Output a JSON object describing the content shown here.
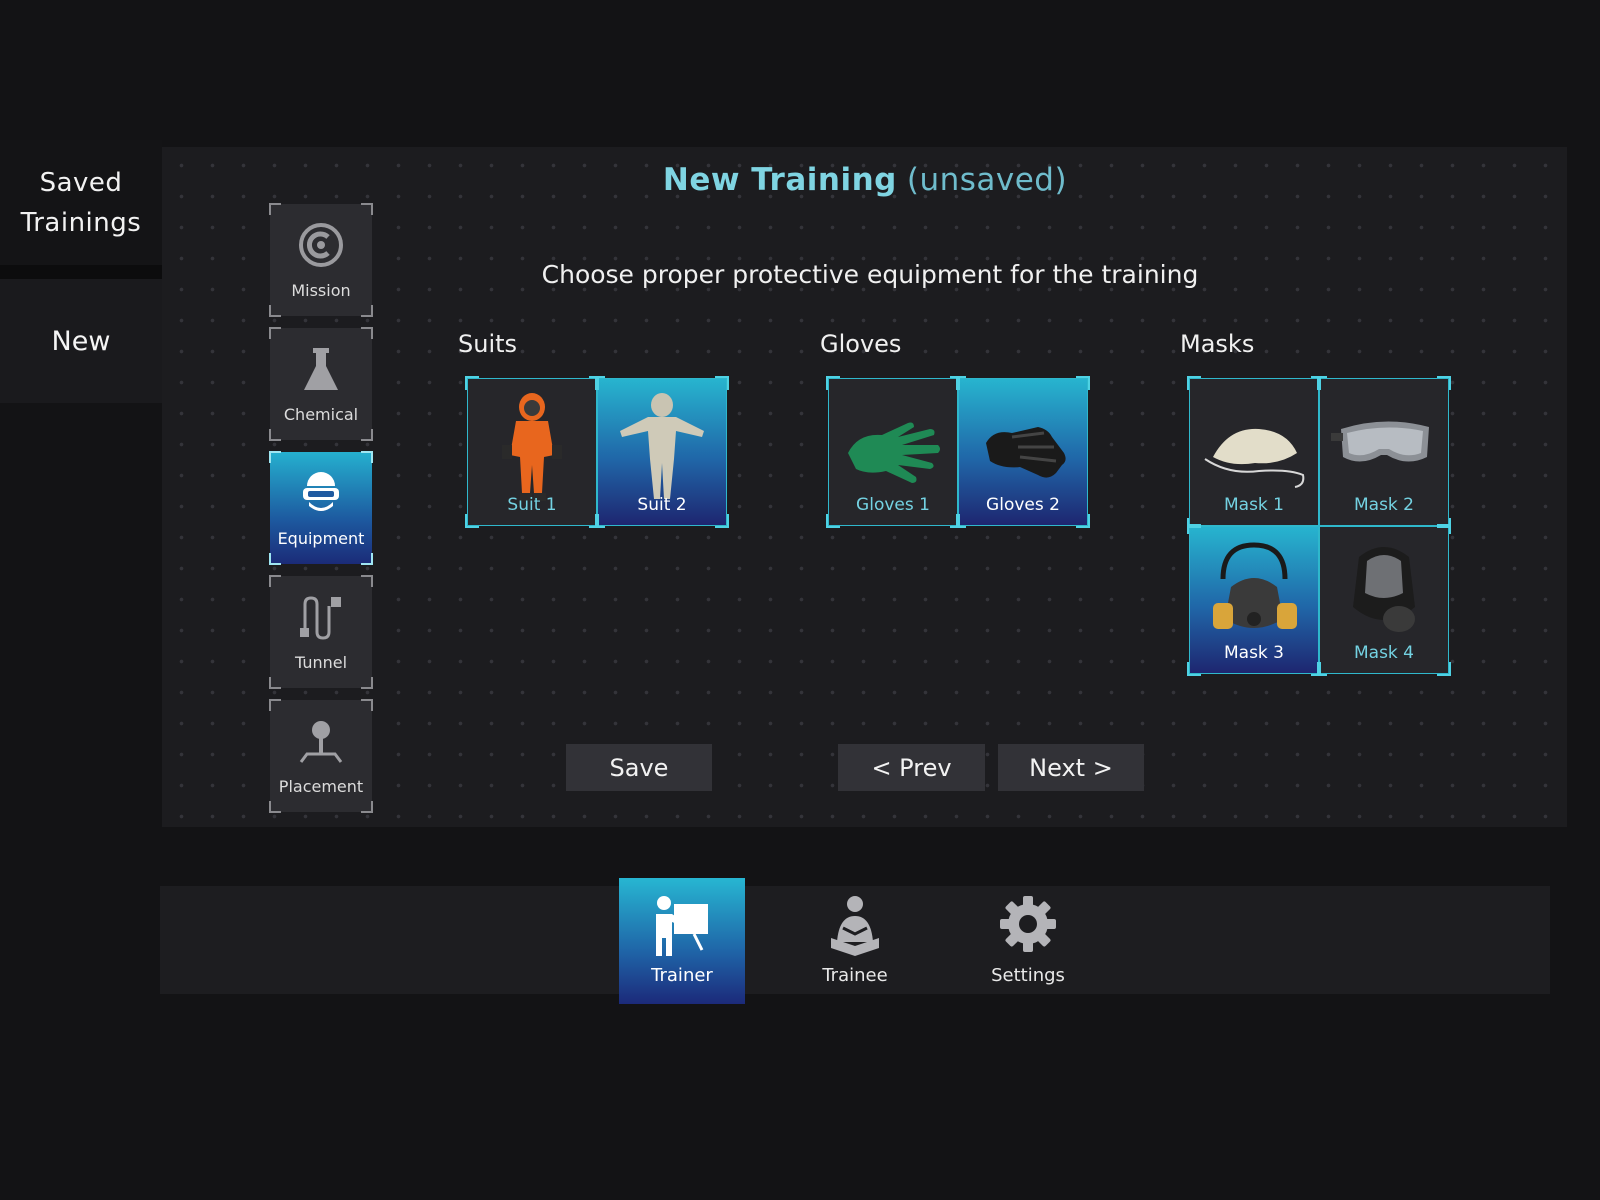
{
  "left_nav": {
    "saved_line1": "Saved",
    "saved_line2": "Trainings",
    "new_label": "New"
  },
  "header": {
    "title": "New Training",
    "title_status": "(unsaved)",
    "instruction": "Choose proper protective equipment for the training"
  },
  "steps": [
    {
      "label": "Mission",
      "icon": "mission-icon"
    },
    {
      "label": "Chemical",
      "icon": "flask-icon"
    },
    {
      "label": "Equipment",
      "icon": "vr-headset-icon",
      "active": true
    },
    {
      "label": "Tunnel",
      "icon": "tunnel-path-icon"
    },
    {
      "label": "Placement",
      "icon": "joystick-pin-icon"
    }
  ],
  "categories": {
    "suits": {
      "title": "Suits",
      "items": [
        {
          "label": "Suit 1",
          "selected": false,
          "color": "#e8661e"
        },
        {
          "label": "Suit 2",
          "selected": true,
          "color": "#c9c4b2"
        }
      ]
    },
    "gloves": {
      "title": "Gloves",
      "items": [
        {
          "label": "Gloves 1",
          "selected": false,
          "color": "#1f8a55"
        },
        {
          "label": "Gloves 2",
          "selected": true,
          "color": "#1a1a1a"
        }
      ]
    },
    "masks": {
      "title": "Masks",
      "items": [
        {
          "label": "Mask 1",
          "selected": false
        },
        {
          "label": "Mask 2",
          "selected": false
        },
        {
          "label": "Mask 3",
          "selected": true
        },
        {
          "label": "Mask 4",
          "selected": false
        }
      ]
    }
  },
  "actions": {
    "save": "Save",
    "prev": "< Prev",
    "next": "Next >"
  },
  "modes": [
    {
      "label": "Trainer",
      "icon": "trainer-icon",
      "active": true
    },
    {
      "label": "Trainee",
      "icon": "trainee-icon",
      "active": false
    },
    {
      "label": "Settings",
      "icon": "gear-icon",
      "active": false
    }
  ],
  "colors": {
    "accent": "#2fb8cc",
    "title": "#7fd4e2",
    "active_gradient_top": "#27b4cf",
    "active_gradient_bottom": "#1e2670"
  }
}
